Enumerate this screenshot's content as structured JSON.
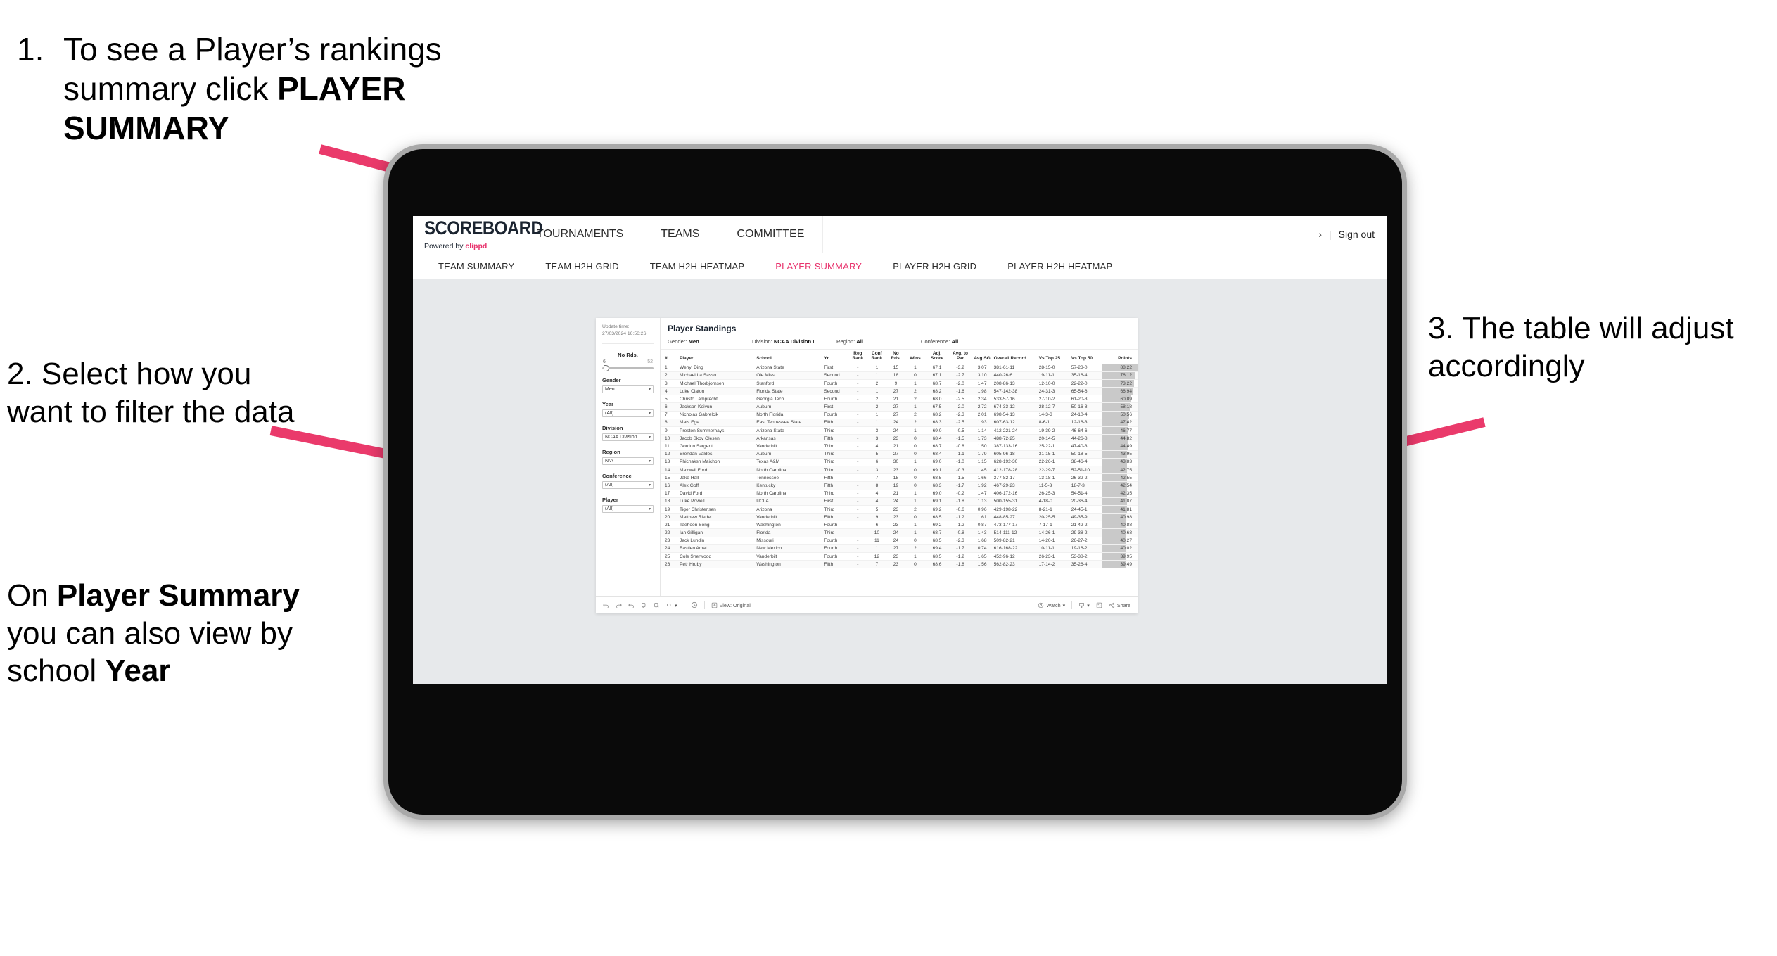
{
  "annotations": {
    "a1": {
      "number": "1.",
      "line1": "To see a Player’s rankings",
      "line2_pre": "summary click ",
      "line2_bold": "PLAYER",
      "line3_bold": "SUMMARY"
    },
    "a2": {
      "text": "2. Select how you want to filter the data"
    },
    "a2b": {
      "pre": "On ",
      "bold1": "Player Summary",
      "mid": " you can also view by school ",
      "bold2": "Year"
    },
    "a3": {
      "text": "3. The table will adjust accordingly"
    },
    "arrow_color": "#ea3a6b"
  },
  "app": {
    "brand": {
      "name": "SCOREBOARD",
      "powered_pre": "Powered by ",
      "powered_brand": "clippd"
    },
    "top_nav": [
      "TOURNAMENTS",
      "TEAMS",
      "COMMITTEE"
    ],
    "top_right": {
      "chevron": "›",
      "divider": "|",
      "sign_out": "Sign out"
    },
    "sub_nav": [
      {
        "label": "TEAM SUMMARY",
        "active": false
      },
      {
        "label": "TEAM H2H GRID",
        "active": false
      },
      {
        "label": "TEAM H2H HEATMAP",
        "active": false
      },
      {
        "label": "PLAYER SUMMARY",
        "active": true
      },
      {
        "label": "PLAYER H2H GRID",
        "active": false
      },
      {
        "label": "PLAYER H2H HEATMAP",
        "active": false
      }
    ],
    "accent": "#e8336d"
  },
  "sidebar": {
    "update_label": "Update time:",
    "update_value": "27/03/2024 16:56:26",
    "no_rds": {
      "label": "No Rds.",
      "min": "6",
      "max": "52"
    },
    "filters": [
      {
        "label": "Gender",
        "value": "Men"
      },
      {
        "label": "Year",
        "value": "(All)"
      },
      {
        "label": "Division",
        "value": "NCAA Division I"
      },
      {
        "label": "Region",
        "value": "N/A"
      },
      {
        "label": "Conference",
        "value": "(All)"
      },
      {
        "label": "Player",
        "value": "(All)"
      }
    ]
  },
  "panel": {
    "title": "Player Standings",
    "meta": [
      {
        "label": "Gender: ",
        "value": "Men"
      },
      {
        "label": "Division: ",
        "value": "NCAA Division I"
      },
      {
        "label": "Region: ",
        "value": "All"
      },
      {
        "label": "Conference: ",
        "value": "All"
      }
    ]
  },
  "table": {
    "columns": [
      "#",
      "Player",
      "School",
      "Yr",
      "Reg Rank",
      "Conf Rank",
      "No Rds.",
      "Wins",
      "Adj. Score",
      "Avg. to Par",
      "Avg SG",
      "Overall Record",
      "Vs Top 25",
      "Vs Top 50",
      "Points"
    ],
    "rows": [
      [
        "1",
        "Wenyi Ding",
        "Arizona State",
        "First",
        "-",
        "1",
        "15",
        "1",
        "67.1",
        "-3.2",
        "3.07",
        "381-61-11",
        "28-15-0",
        "57-23-0",
        "88.22"
      ],
      [
        "2",
        "Michael La Sasso",
        "Ole Miss",
        "Second",
        "-",
        "1",
        "18",
        "0",
        "67.1",
        "-2.7",
        "3.10",
        "440-26-6",
        "19-11-1",
        "35-16-4",
        "76.12"
      ],
      [
        "3",
        "Michael Thorbjornsen",
        "Stanford",
        "Fourth",
        "-",
        "2",
        "9",
        "1",
        "68.7",
        "-2.0",
        "1.47",
        "208-86-13",
        "12-10-0",
        "22-22-0",
        "73.22"
      ],
      [
        "4",
        "Luke Claton",
        "Florida State",
        "Second",
        "-",
        "1",
        "27",
        "2",
        "68.2",
        "-1.6",
        "1.98",
        "547-142-38",
        "24-31-3",
        "65-54-6",
        "66.94"
      ],
      [
        "5",
        "Christo Lamprecht",
        "Georgia Tech",
        "Fourth",
        "-",
        "2",
        "21",
        "2",
        "68.0",
        "-2.5",
        "2.34",
        "533-57-16",
        "27-10-2",
        "61-20-3",
        "60.89"
      ],
      [
        "6",
        "Jackson Koivun",
        "Auburn",
        "First",
        "-",
        "2",
        "27",
        "1",
        "67.5",
        "-2.0",
        "2.72",
        "674-33-12",
        "28-12-7",
        "50-16-8",
        "58.18"
      ],
      [
        "7",
        "Nicholas Gabrelcik",
        "North Florida",
        "Fourth",
        "-",
        "1",
        "27",
        "2",
        "68.2",
        "-2.3",
        "2.01",
        "698-54-13",
        "14-3-3",
        "24-10-4",
        "50.56"
      ],
      [
        "8",
        "Mats Ege",
        "East Tennessee State",
        "Fifth",
        "-",
        "1",
        "24",
        "2",
        "68.3",
        "-2.5",
        "1.93",
        "607-63-12",
        "8-6-1",
        "12-16-3",
        "47.42"
      ],
      [
        "9",
        "Preston Summerhays",
        "Arizona State",
        "Third",
        "-",
        "3",
        "24",
        "1",
        "69.0",
        "-0.5",
        "1.14",
        "412-221-24",
        "19-39-2",
        "46-64-6",
        "46.77"
      ],
      [
        "10",
        "Jacob Skov Olesen",
        "Arkansas",
        "Fifth",
        "-",
        "3",
        "23",
        "0",
        "68.4",
        "-1.5",
        "1.73",
        "488-72-25",
        "20-14-5",
        "44-26-8",
        "44.82"
      ],
      [
        "11",
        "Gordon Sargent",
        "Vanderbilt",
        "Third",
        "-",
        "4",
        "21",
        "0",
        "68.7",
        "-0.8",
        "1.50",
        "387-133-16",
        "25-22-1",
        "47-40-3",
        "44.49"
      ],
      [
        "12",
        "Brendan Valdes",
        "Auburn",
        "Third",
        "-",
        "5",
        "27",
        "0",
        "68.4",
        "-1.1",
        "1.79",
        "605-96-18",
        "31-15-1",
        "50-18-5",
        "43.95"
      ],
      [
        "13",
        "Phichaksn Maichon",
        "Texas A&M",
        "Third",
        "-",
        "6",
        "30",
        "1",
        "69.0",
        "-1.0",
        "1.15",
        "628-192-30",
        "22-26-1",
        "38-46-4",
        "43.83"
      ],
      [
        "14",
        "Maxwell Ford",
        "North Carolina",
        "Third",
        "-",
        "3",
        "23",
        "0",
        "69.1",
        "-0.3",
        "1.45",
        "412-178-28",
        "22-29-7",
        "52-51-10",
        "42.75"
      ],
      [
        "15",
        "Jake Hall",
        "Tennessee",
        "Fifth",
        "-",
        "7",
        "18",
        "0",
        "68.5",
        "-1.5",
        "1.66",
        "377-82-17",
        "13-18-1",
        "26-32-2",
        "42.55"
      ],
      [
        "16",
        "Alex Goff",
        "Kentucky",
        "Fifth",
        "-",
        "8",
        "19",
        "0",
        "68.3",
        "-1.7",
        "1.92",
        "467-29-23",
        "11-5-3",
        "18-7-3",
        "42.54"
      ],
      [
        "17",
        "David Ford",
        "North Carolina",
        "Third",
        "-",
        "4",
        "21",
        "1",
        "69.0",
        "-0.2",
        "1.47",
        "406-172-16",
        "26-25-3",
        "54-51-4",
        "42.35"
      ],
      [
        "18",
        "Luke Powell",
        "UCLA",
        "First",
        "-",
        "4",
        "24",
        "1",
        "69.1",
        "-1.8",
        "1.13",
        "500-155-31",
        "4-18-0",
        "20-36-4",
        "41.87"
      ],
      [
        "19",
        "Tiger Christensen",
        "Arizona",
        "Third",
        "-",
        "5",
        "23",
        "2",
        "69.2",
        "-0.6",
        "0.96",
        "429-198-22",
        "8-21-1",
        "24-45-1",
        "41.81"
      ],
      [
        "20",
        "Matthew Riedel",
        "Vanderbilt",
        "Fifth",
        "-",
        "9",
        "23",
        "0",
        "68.5",
        "-1.2",
        "1.61",
        "448-85-27",
        "20-25-5",
        "49-35-9",
        "40.98"
      ],
      [
        "21",
        "Taehoon Song",
        "Washington",
        "Fourth",
        "-",
        "6",
        "23",
        "1",
        "69.2",
        "-1.2",
        "0.87",
        "473-177-17",
        "7-17-1",
        "21-42-2",
        "40.88"
      ],
      [
        "22",
        "Ian Gilligan",
        "Florida",
        "Third",
        "-",
        "10",
        "24",
        "1",
        "68.7",
        "-0.8",
        "1.43",
        "514-111-12",
        "14-26-1",
        "29-38-2",
        "40.68"
      ],
      [
        "23",
        "Jack Lundin",
        "Missouri",
        "Fourth",
        "-",
        "11",
        "24",
        "0",
        "68.5",
        "-2.3",
        "1.68",
        "509-82-21",
        "14-20-1",
        "26-27-2",
        "40.27"
      ],
      [
        "24",
        "Bastien Amat",
        "New Mexico",
        "Fourth",
        "-",
        "1",
        "27",
        "2",
        "69.4",
        "-1.7",
        "0.74",
        "616-168-22",
        "10-11-1",
        "19-16-2",
        "40.02"
      ],
      [
        "25",
        "Cole Sherwood",
        "Vanderbilt",
        "Fourth",
        "-",
        "12",
        "23",
        "1",
        "68.5",
        "-1.2",
        "1.65",
        "452-96-12",
        "26-23-1",
        "53-38-2",
        "39.95"
      ],
      [
        "26",
        "Petr Hruby",
        "Washington",
        "Fifth",
        "-",
        "7",
        "23",
        "0",
        "68.6",
        "-1.8",
        "1.56",
        "562-82-23",
        "17-14-2",
        "35-26-4",
        "39.49"
      ]
    ]
  },
  "toolbar": {
    "left_icons": [
      "undo-icon",
      "redo-icon",
      "revert-icon",
      "pause-icon",
      "resume-icon",
      "refresh-icon"
    ],
    "dropdown_caret": "▾",
    "clock_icon": "clock-icon",
    "view_label": "View: Original",
    "watch_label": "Watch",
    "watch_caret": "▾",
    "download_caret": "▾",
    "share_label": "Share"
  }
}
